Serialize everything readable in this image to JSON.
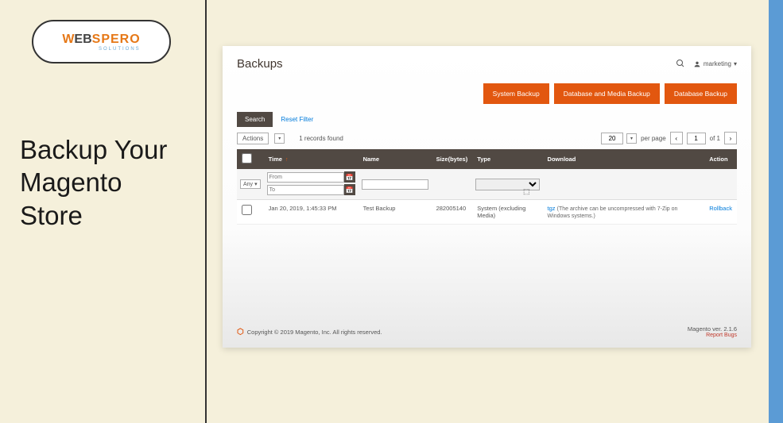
{
  "presentation": {
    "title": "Backup Your\nMagento\nStore",
    "logo": {
      "w": "W",
      "eb": "EB",
      "spero": "SPERO",
      "solutions": "SOLUTIONS"
    }
  },
  "admin": {
    "page_title": "Backups",
    "user_menu": "marketing",
    "buttons": {
      "system_backup": "System Backup",
      "db_media_backup": "Database and Media Backup",
      "db_backup": "Database Backup"
    },
    "filters": {
      "search_label": "Search",
      "reset_label": "Reset Filter"
    },
    "grid_controls": {
      "actions_label": "Actions",
      "records_found": "1 records found",
      "per_page_value": "20",
      "per_page_label": "per page",
      "page_current": "1",
      "page_of": "of 1"
    },
    "columns": {
      "time": "Time",
      "name": "Name",
      "size": "Size(bytes)",
      "type": "Type",
      "download": "Download",
      "action": "Action"
    },
    "filter_placeholders": {
      "any": "Any",
      "from": "From",
      "to": "To"
    },
    "rows": [
      {
        "time": "Jan 20, 2019, 1:45:33 PM",
        "name": "Test Backup",
        "size": "282005140",
        "type": "System (excluding Media)",
        "download_link": "tgz",
        "download_note": "(The archive can be uncompressed with 7-Zip on Windows systems.)",
        "action": "Rollback"
      }
    ],
    "footer": {
      "copyright": "Copyright © 2019 Magento, Inc. All rights reserved.",
      "version": "Magento ver. 2.1.6",
      "report_bugs": "Report Bugs"
    }
  }
}
